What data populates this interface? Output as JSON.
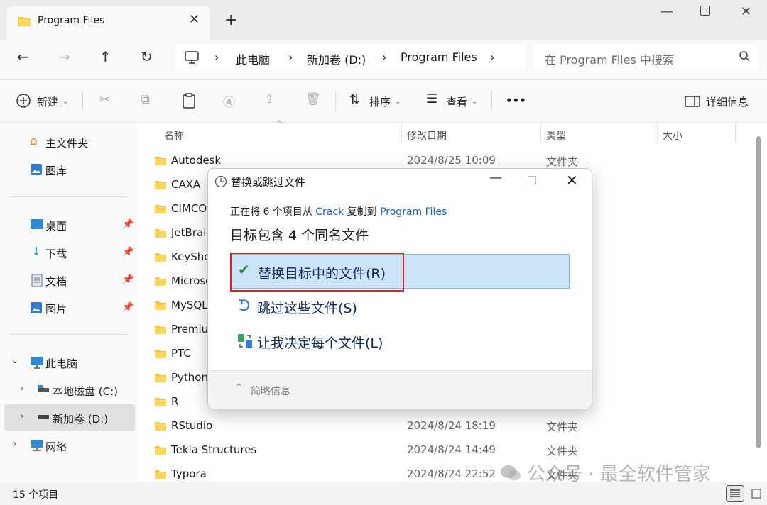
{
  "tab": {
    "title": "Program Files"
  },
  "address": {
    "segments": [
      "此电脑",
      "新加卷 (D:)",
      "Program Files"
    ],
    "search_placeholder": "在 Program Files 中搜索"
  },
  "toolbar": {
    "new_label": "新建",
    "sort_label": "排序",
    "view_label": "查看",
    "more_label": "•••",
    "details_label": "详细信息"
  },
  "nav": {
    "home": "主文件夹",
    "gallery": "图库",
    "desktop": "桌面",
    "downloads": "下载",
    "documents": "文档",
    "pictures": "图片",
    "this_pc": "此电脑",
    "local_c": "本地磁盘 (C:)",
    "volume_d": "新加卷 (D:)",
    "network": "网络"
  },
  "columns": {
    "name": "名称",
    "modified": "修改日期",
    "type": "类型",
    "size": "大小"
  },
  "files": [
    {
      "name": "Autodesk",
      "date": "2024/8/25 10:09",
      "type": "文件夹"
    },
    {
      "name": "CAXA",
      "date": "",
      "type": ""
    },
    {
      "name": "CIMCO",
      "date": "",
      "type": ""
    },
    {
      "name": "JetBrain",
      "date": "",
      "type": ""
    },
    {
      "name": "KeySho",
      "date": "",
      "type": ""
    },
    {
      "name": "Microso",
      "date": "",
      "type": ""
    },
    {
      "name": "MySQL",
      "date": "",
      "type": ""
    },
    {
      "name": "Premium",
      "date": "",
      "type": ""
    },
    {
      "name": "PTC",
      "date": "",
      "type": ""
    },
    {
      "name": "Python",
      "date": "",
      "type": ""
    },
    {
      "name": "R",
      "date": "",
      "type": ""
    },
    {
      "name": "RStudio",
      "date": "2024/8/24 18:19",
      "type": "文件夹"
    },
    {
      "name": "Tekla Structures",
      "date": "2024/8/24 14:49",
      "type": "文件夹"
    },
    {
      "name": "Typora",
      "date": "2024/8/24 22:52",
      "type": "文件夹"
    }
  ],
  "status": {
    "count": "15 个项目"
  },
  "watermark": {
    "text": "公众号 · 最全软件管家"
  },
  "dialog": {
    "title": "替换或跳过文件",
    "msg_prefix": "正在将 6 个项目从",
    "msg_source": "Crack",
    "msg_middle": "复制到",
    "msg_dest": "Program Files",
    "heading": "目标包含 4 个同名文件",
    "option_replace": "替换目标中的文件(R)",
    "option_skip": "跳过这些文件(S)",
    "option_decide": "让我决定每个文件(L)",
    "footer": "简略信息"
  }
}
